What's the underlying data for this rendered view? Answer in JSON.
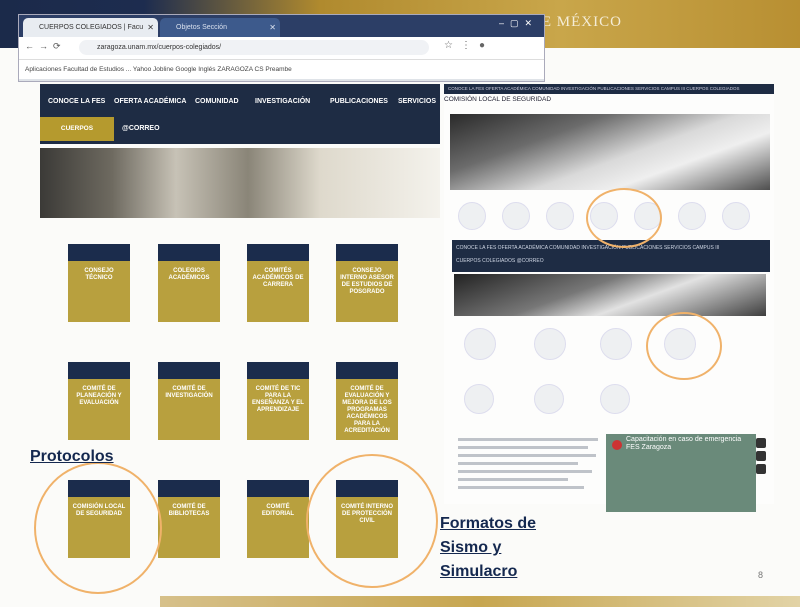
{
  "header": {
    "title": "DE MÉXICO"
  },
  "browser": {
    "tab1": "CUERPOS COLEGIADOS | Facu",
    "tab2": "Objetos Sección",
    "url": "zaragoza.unam.mx/cuerpos-colegiados/",
    "bookmarks": "Aplicaciones   Facultad de Estudios ...   Yahoo   Jobline   Google   Inglés   ZARAGOZA   CS   Preambe"
  },
  "left_page": {
    "nav": [
      "CONOCE LA FES",
      "OFERTA ACADÉMICA",
      "COMUNIDAD",
      "INVESTIGACIÓN",
      "PUBLICACIONES",
      "SERVICIOS"
    ],
    "cuerpos": "CUERPOS COLEGIADOS",
    "correo": "@CORREO",
    "cards": [
      "CONSEJO TÉCNICO",
      "COLEGIOS ACADÉMICOS",
      "COMITÉS ACADÉMICOS DE CARRERA",
      "CONSEJO INTERNO ASESOR DE ESTUDIOS DE POSGRADO",
      "COMITÉ DE PLANEACIÓN Y EVALUACIÓN",
      "COMITÉ DE INVESTIGACIÓN",
      "COMITÉ DE TIC PARA LA ENSEÑANZA Y EL APRENDIZAJE",
      "COMITÉ DE EVALUACIÓN Y MEJORA DE LOS PROGRAMAS ACADÉMICOS PARA LA ACREDITACIÓN",
      "COMISIÓN LOCAL DE SEGURIDAD",
      "COMITÉ DE BIBLIOTECAS",
      "COMITÉ EDITORIAL",
      "COMITÉ INTERNO DE PROTECCIÓN CIVIL"
    ]
  },
  "right_page": {
    "nav_top": "CONOCE LA FES   OFERTA ACADÉMICA   COMUNIDAD   INVESTIGACIÓN   PUBLICACIONES   SERVICIOS   CAMPUS III   CUERPOS COLEGIADOS",
    "title": "COMISIÓN LOCAL DE SEGURIDAD",
    "nav2_line1": "CONOCE LA FES    OFERTA ACADÉMICA    COMUNIDAD    INVESTIGACIÓN    PUBLICACIONES    SERVICIOS    CAMPUS III",
    "nav2_line2": "CUERPOS COLEGIADOS    @CORREO",
    "video_title": "Capacitación en caso de emergencia FES Zaragoza"
  },
  "labels": {
    "protocolos": "Protocolos",
    "formatos_l1": "Formatos de",
    "formatos_l2": "Sismo y",
    "formatos_l3": "Simulacro"
  },
  "slide": {
    "page_number": "8"
  },
  "colors": {
    "navy": "#1e2c44",
    "gold": "#b8a03e",
    "ring": "#f0b26a",
    "label": "#14284f"
  }
}
